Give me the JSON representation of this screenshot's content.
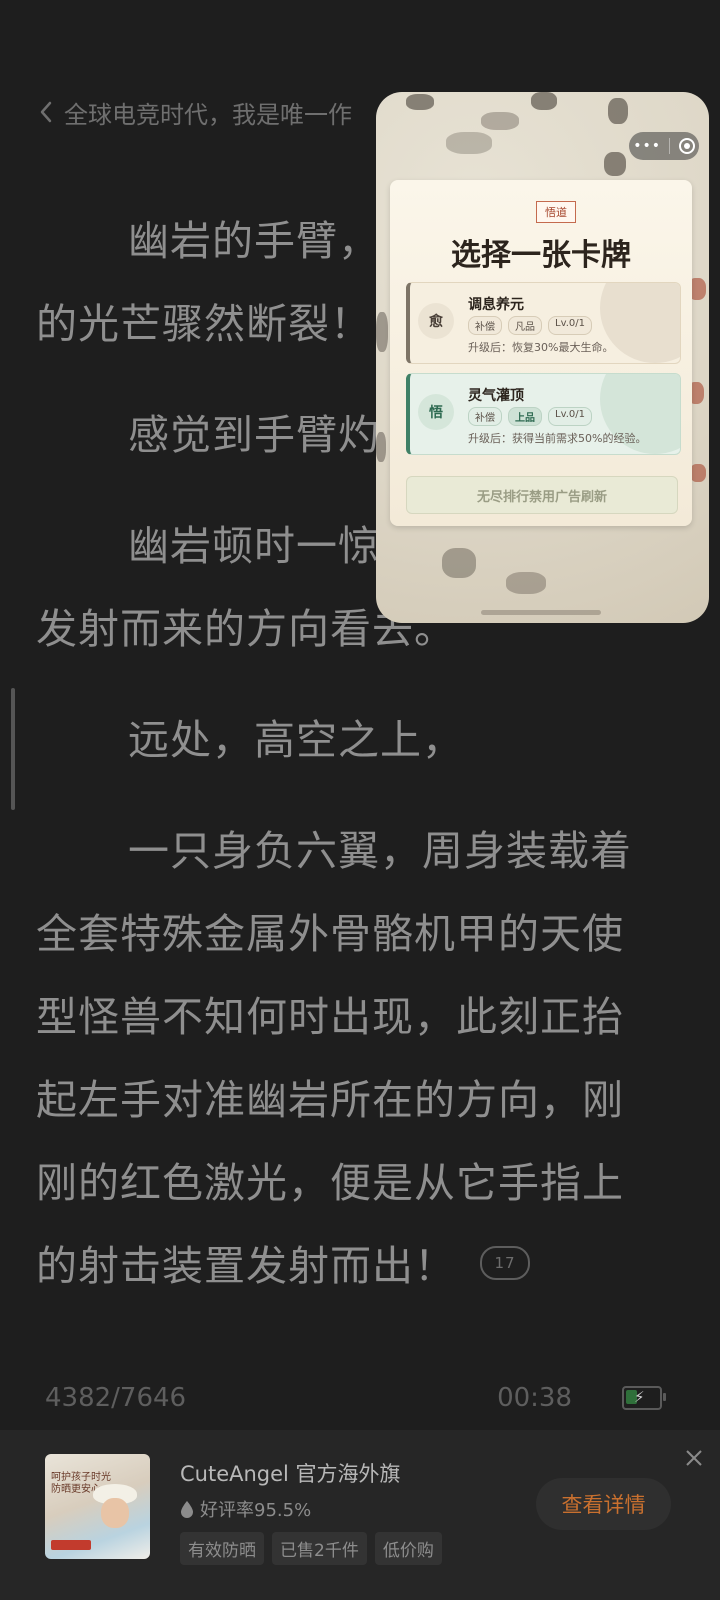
{
  "reader": {
    "book_title": "全球电竞时代，我是唯一作",
    "paragraphs": [
      {
        "lines": [
          "幽岩的手臂，",
          "的光芒骤然断裂！"
        ]
      },
      {
        "lines": [
          "感觉到手臂灼"
        ]
      },
      {
        "lines": [
          "幽岩顿时一惊",
          "发射而来的方向看去。"
        ]
      },
      {
        "lines": [
          "远处，高空之上，"
        ]
      },
      {
        "lines": [
          "一只身负六翼，周身装载着",
          "全套特殊金属外骨骼机甲的天使",
          "型怪兽不知何时出现，此刻正抬",
          "起左手对准幽岩所在的方向，刚",
          "刚的红色激光，便是从它手指上",
          "的射击装置发射而出！"
        ]
      }
    ],
    "comment_count": "17",
    "progress": "4382/7646",
    "time": "00:38",
    "battery_level": 0.35
  },
  "popup": {
    "badge": "悟道",
    "title": "选择一张卡牌",
    "options": [
      {
        "icon_char": "愈",
        "name": "调息养元",
        "tags": [
          "补偿",
          "凡品",
          "Lv.0/1"
        ],
        "desc": "升级后：恢复30%最大生命。"
      },
      {
        "icon_char": "悟",
        "name": "灵气灌顶",
        "tags": [
          "补偿",
          "上品",
          "Lv.0/1"
        ],
        "desc": "升级后：获得当前需求50%的经验。"
      }
    ],
    "refresh_label": "无尽排行禁用广告刷新",
    "capsule_more": "•••"
  },
  "ad": {
    "title": "CuteAngel 官方海外旗",
    "rating": "好评率95.5%",
    "tags": [
      "有效防晒",
      "已售2千件",
      "低价购"
    ],
    "cta": "查看详情",
    "thumb_text": "呵护孩子时光\n防晒更安心",
    "accent": "#c9702f"
  }
}
